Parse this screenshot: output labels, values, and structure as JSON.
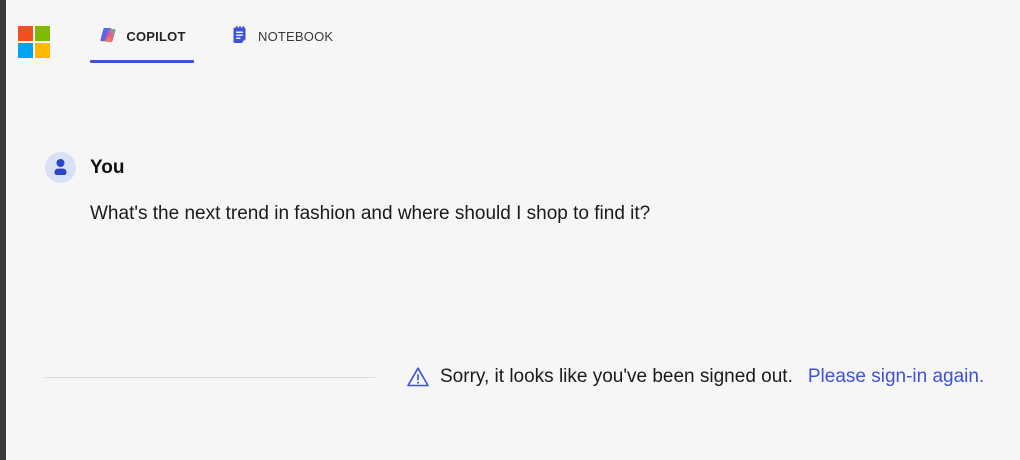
{
  "header": {
    "logo_icon": "microsoft-logo-icon",
    "tabs": [
      {
        "label": "COPILOT",
        "icon": "copilot-icon",
        "active": true
      },
      {
        "label": "NOTEBOOK",
        "icon": "notebook-icon",
        "active": false
      }
    ]
  },
  "conversation": {
    "user": {
      "avatar_icon": "user-avatar-icon",
      "name": "You",
      "message": "What's the next trend in fashion and where should I shop to find it?"
    },
    "status": {
      "icon": "warning-icon",
      "text": "Sorry, it looks like you've been signed out.",
      "link_text": "Please sign-in again."
    }
  },
  "colors": {
    "background": "#f6f6f6",
    "accent": "#3d52d5",
    "avatar_bg": "#d9e1f6",
    "ms_red": "#f25022",
    "ms_green": "#7fba00",
    "ms_blue": "#00a4ef",
    "ms_yellow": "#ffb900"
  }
}
